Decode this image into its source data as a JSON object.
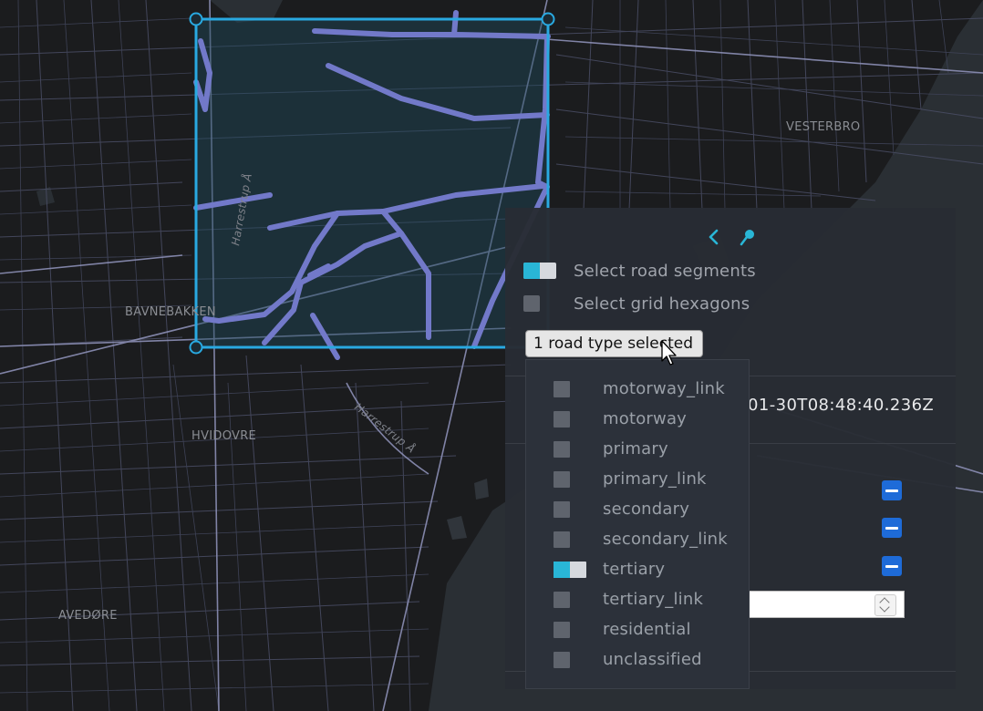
{
  "map": {
    "place_labels": [
      "VESTERBRO",
      "BAVNEBAKKEN",
      "HVIDOVRE",
      "AVEDØRE"
    ],
    "street_labels": [
      "Harrestrup Å",
      "Harrestrup Å"
    ],
    "colors": {
      "background": "#1b1c1e",
      "streets": "#4f5470",
      "selected_roads": "#7279c9",
      "selection_box": "#29a9e1",
      "water": "#2b3035"
    }
  },
  "panel": {
    "collapse_icon": "chevron-left-icon",
    "pin_icon": "pin-icon",
    "toggles": [
      {
        "label": "Select road segments",
        "on": true
      },
      {
        "label": "Select grid hexagons",
        "on": false
      }
    ],
    "timestamp_visible": "01-30T08:48:40.236Z",
    "remove_buttons": [
      "minus-icon",
      "minus-icon",
      "minus-icon"
    ]
  },
  "road_type_dropdown": {
    "button_label": "1 road type selected",
    "options": [
      {
        "label": "motorway_link",
        "checked": false
      },
      {
        "label": "motorway",
        "checked": false
      },
      {
        "label": "primary",
        "checked": false
      },
      {
        "label": "primary_link",
        "checked": false
      },
      {
        "label": "secondary",
        "checked": false
      },
      {
        "label": "secondary_link",
        "checked": false
      },
      {
        "label": "tertiary",
        "checked": true
      },
      {
        "label": "tertiary_link",
        "checked": false
      },
      {
        "label": "residential",
        "checked": false
      },
      {
        "label": "unclassified",
        "checked": false
      }
    ]
  }
}
